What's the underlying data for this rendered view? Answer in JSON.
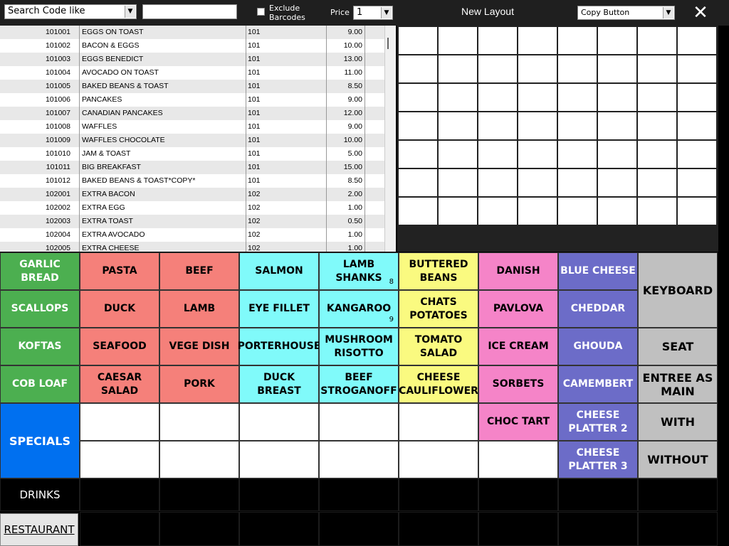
{
  "toolbar": {
    "search_mode": "Search Code like",
    "search_value": "",
    "exclude_barcodes_label": "Exclude\nBarcodes",
    "price_label": "Price",
    "price_value": "1",
    "title": "New Layout",
    "copy_mode": "Copy Button",
    "close_label": "✕"
  },
  "items": [
    {
      "code": "101001",
      "name": "EGGS ON TOAST",
      "group": "101",
      "price": "9.00"
    },
    {
      "code": "101002",
      "name": "BACON & EGGS",
      "group": "101",
      "price": "10.00"
    },
    {
      "code": "101003",
      "name": "EGGS BENEDICT",
      "group": "101",
      "price": "13.00"
    },
    {
      "code": "101004",
      "name": "AVOCADO ON TOAST",
      "group": "101",
      "price": "11.00"
    },
    {
      "code": "101005",
      "name": "BAKED BEANS & TOAST",
      "group": "101",
      "price": "8.50"
    },
    {
      "code": "101006",
      "name": "PANCAKES",
      "group": "101",
      "price": "9.00"
    },
    {
      "code": "101007",
      "name": "CANADIAN PANCAKES",
      "group": "101",
      "price": "12.00"
    },
    {
      "code": "101008",
      "name": "WAFFLES",
      "group": "101",
      "price": "9.00"
    },
    {
      "code": "101009",
      "name": "WAFFLES CHOCOLATE",
      "group": "101",
      "price": "10.00"
    },
    {
      "code": "101010",
      "name": "JAM & TOAST",
      "group": "101",
      "price": "5.00"
    },
    {
      "code": "101011",
      "name": "BIG BREAKFAST",
      "group": "101",
      "price": "15.00"
    },
    {
      "code": "101012",
      "name": "BAKED BEANS & TOAST*COPY*",
      "group": "101",
      "price": "8.50"
    },
    {
      "code": "102001",
      "name": "EXTRA BACON",
      "group": "102",
      "price": "2.00"
    },
    {
      "code": "102002",
      "name": "EXTRA EGG",
      "group": "102",
      "price": "1.00"
    },
    {
      "code": "102003",
      "name": "EXTRA TOAST",
      "group": "102",
      "price": "0.50"
    },
    {
      "code": "102004",
      "name": "EXTRA AVOCADO",
      "group": "102",
      "price": "1.00"
    },
    {
      "code": "102005",
      "name": "EXTRA CHEESE",
      "group": "102",
      "price": "1.00"
    }
  ],
  "buttons": [
    {
      "label": "GARLIC BREAD",
      "color": "green",
      "sub": ""
    },
    {
      "label": "PASTA",
      "color": "red",
      "sub": ""
    },
    {
      "label": "BEEF",
      "color": "red",
      "sub": ""
    },
    {
      "label": "SALMON",
      "color": "cyan",
      "sub": ""
    },
    {
      "label": "LAMB SHANKS",
      "color": "cyan",
      "sub": "8"
    },
    {
      "label": "BUTTERED BEANS",
      "color": "yellow",
      "sub": ""
    },
    {
      "label": "DANISH",
      "color": "pink",
      "sub": ""
    },
    {
      "label": "BLUE CHEESE",
      "color": "purple",
      "sub": ""
    },
    {
      "label": "SCALLOPS",
      "color": "green",
      "sub": ""
    },
    {
      "label": "DUCK",
      "color": "red",
      "sub": ""
    },
    {
      "label": "LAMB",
      "color": "red",
      "sub": ""
    },
    {
      "label": "EYE FILLET",
      "color": "cyan",
      "sub": ""
    },
    {
      "label": "KANGAROO",
      "color": "cyan",
      "sub": "9"
    },
    {
      "label": "CHATS POTATOES",
      "color": "yellow",
      "sub": ""
    },
    {
      "label": "PAVLOVA",
      "color": "pink",
      "sub": ""
    },
    {
      "label": "CHEDDAR",
      "color": "purple",
      "sub": ""
    },
    {
      "label": "KOFTAS",
      "color": "green",
      "sub": ""
    },
    {
      "label": "SEAFOOD",
      "color": "red",
      "sub": ""
    },
    {
      "label": "VEGE DISH",
      "color": "red",
      "sub": ""
    },
    {
      "label": "PORTERHOUSE",
      "color": "cyan",
      "sub": ""
    },
    {
      "label": "MUSHROOM RISOTTO",
      "color": "cyan",
      "sub": ""
    },
    {
      "label": "TOMATO SALAD",
      "color": "yellow",
      "sub": ""
    },
    {
      "label": "ICE CREAM",
      "color": "pink",
      "sub": ""
    },
    {
      "label": "GHOUDA",
      "color": "purple",
      "sub": ""
    },
    {
      "label": "COB LOAF",
      "color": "green",
      "sub": ""
    },
    {
      "label": "CAESAR SALAD",
      "color": "red",
      "sub": ""
    },
    {
      "label": "PORK",
      "color": "red",
      "sub": ""
    },
    {
      "label": "DUCK BREAST",
      "color": "cyan",
      "sub": ""
    },
    {
      "label": "BEEF STROGANOFF",
      "color": "cyan",
      "sub": ""
    },
    {
      "label": "CHEESE CAULIFLOWER",
      "color": "yellow",
      "sub": ""
    },
    {
      "label": "SORBETS",
      "color": "pink",
      "sub": ""
    },
    {
      "label": "CAMEMBERT",
      "color": "purple",
      "sub": ""
    },
    {
      "label": "CHOC TART",
      "color": "pink",
      "sub": ""
    },
    {
      "label": "CHEESE PLATTER 2",
      "color": "purple",
      "sub": ""
    },
    {
      "label": "CHEESE PLATTER 3",
      "color": "purple",
      "sub": ""
    }
  ],
  "side_buttons": {
    "keyboard": "KEYBOARD",
    "seat": "SEAT",
    "entree_as_main": "ENTREE AS MAIN",
    "with": "WITH",
    "without": "WITHOUT"
  },
  "specials_label": "SPECIALS",
  "drinks_label": "DRINKS",
  "restaurant_label": "RESTAURANT",
  "colors": {
    "green": "#4caf50",
    "red": "#f5807a",
    "cyan": "#80fafa",
    "yellow": "#fafa80",
    "pink": "#f584c8",
    "purple": "#6c6cc8",
    "gray": "#c0c0c0",
    "blue": "#0070f0"
  }
}
